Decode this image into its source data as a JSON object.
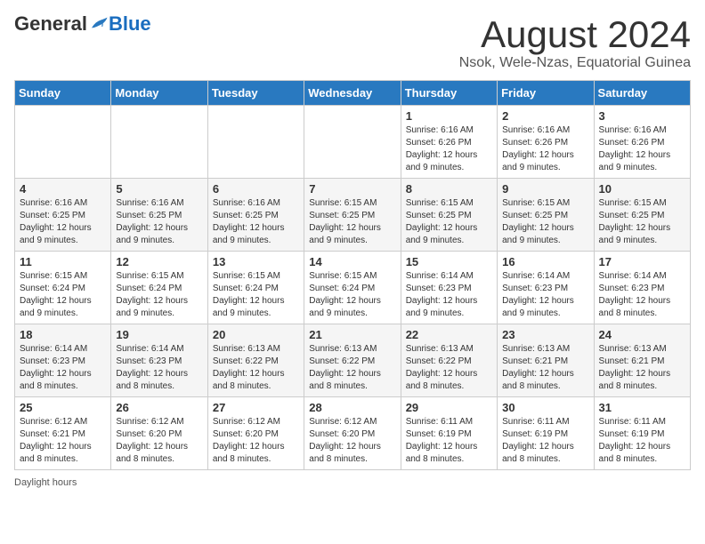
{
  "logo": {
    "general": "General",
    "blue": "Blue"
  },
  "header": {
    "title": "August 2024",
    "subtitle": "Nsok, Wele-Nzas, Equatorial Guinea"
  },
  "weekdays": [
    "Sunday",
    "Monday",
    "Tuesday",
    "Wednesday",
    "Thursday",
    "Friday",
    "Saturday"
  ],
  "weeks": [
    [
      {
        "day": "",
        "info": ""
      },
      {
        "day": "",
        "info": ""
      },
      {
        "day": "",
        "info": ""
      },
      {
        "day": "",
        "info": ""
      },
      {
        "day": "1",
        "info": "Sunrise: 6:16 AM\nSunset: 6:26 PM\nDaylight: 12 hours\nand 9 minutes."
      },
      {
        "day": "2",
        "info": "Sunrise: 6:16 AM\nSunset: 6:26 PM\nDaylight: 12 hours\nand 9 minutes."
      },
      {
        "day": "3",
        "info": "Sunrise: 6:16 AM\nSunset: 6:26 PM\nDaylight: 12 hours\nand 9 minutes."
      }
    ],
    [
      {
        "day": "4",
        "info": "Sunrise: 6:16 AM\nSunset: 6:25 PM\nDaylight: 12 hours\nand 9 minutes."
      },
      {
        "day": "5",
        "info": "Sunrise: 6:16 AM\nSunset: 6:25 PM\nDaylight: 12 hours\nand 9 minutes."
      },
      {
        "day": "6",
        "info": "Sunrise: 6:16 AM\nSunset: 6:25 PM\nDaylight: 12 hours\nand 9 minutes."
      },
      {
        "day": "7",
        "info": "Sunrise: 6:15 AM\nSunset: 6:25 PM\nDaylight: 12 hours\nand 9 minutes."
      },
      {
        "day": "8",
        "info": "Sunrise: 6:15 AM\nSunset: 6:25 PM\nDaylight: 12 hours\nand 9 minutes."
      },
      {
        "day": "9",
        "info": "Sunrise: 6:15 AM\nSunset: 6:25 PM\nDaylight: 12 hours\nand 9 minutes."
      },
      {
        "day": "10",
        "info": "Sunrise: 6:15 AM\nSunset: 6:25 PM\nDaylight: 12 hours\nand 9 minutes."
      }
    ],
    [
      {
        "day": "11",
        "info": "Sunrise: 6:15 AM\nSunset: 6:24 PM\nDaylight: 12 hours\nand 9 minutes."
      },
      {
        "day": "12",
        "info": "Sunrise: 6:15 AM\nSunset: 6:24 PM\nDaylight: 12 hours\nand 9 minutes."
      },
      {
        "day": "13",
        "info": "Sunrise: 6:15 AM\nSunset: 6:24 PM\nDaylight: 12 hours\nand 9 minutes."
      },
      {
        "day": "14",
        "info": "Sunrise: 6:15 AM\nSunset: 6:24 PM\nDaylight: 12 hours\nand 9 minutes."
      },
      {
        "day": "15",
        "info": "Sunrise: 6:14 AM\nSunset: 6:23 PM\nDaylight: 12 hours\nand 9 minutes."
      },
      {
        "day": "16",
        "info": "Sunrise: 6:14 AM\nSunset: 6:23 PM\nDaylight: 12 hours\nand 9 minutes."
      },
      {
        "day": "17",
        "info": "Sunrise: 6:14 AM\nSunset: 6:23 PM\nDaylight: 12 hours\nand 8 minutes."
      }
    ],
    [
      {
        "day": "18",
        "info": "Sunrise: 6:14 AM\nSunset: 6:23 PM\nDaylight: 12 hours\nand 8 minutes."
      },
      {
        "day": "19",
        "info": "Sunrise: 6:14 AM\nSunset: 6:23 PM\nDaylight: 12 hours\nand 8 minutes."
      },
      {
        "day": "20",
        "info": "Sunrise: 6:13 AM\nSunset: 6:22 PM\nDaylight: 12 hours\nand 8 minutes."
      },
      {
        "day": "21",
        "info": "Sunrise: 6:13 AM\nSunset: 6:22 PM\nDaylight: 12 hours\nand 8 minutes."
      },
      {
        "day": "22",
        "info": "Sunrise: 6:13 AM\nSunset: 6:22 PM\nDaylight: 12 hours\nand 8 minutes."
      },
      {
        "day": "23",
        "info": "Sunrise: 6:13 AM\nSunset: 6:21 PM\nDaylight: 12 hours\nand 8 minutes."
      },
      {
        "day": "24",
        "info": "Sunrise: 6:13 AM\nSunset: 6:21 PM\nDaylight: 12 hours\nand 8 minutes."
      }
    ],
    [
      {
        "day": "25",
        "info": "Sunrise: 6:12 AM\nSunset: 6:21 PM\nDaylight: 12 hours\nand 8 minutes."
      },
      {
        "day": "26",
        "info": "Sunrise: 6:12 AM\nSunset: 6:20 PM\nDaylight: 12 hours\nand 8 minutes."
      },
      {
        "day": "27",
        "info": "Sunrise: 6:12 AM\nSunset: 6:20 PM\nDaylight: 12 hours\nand 8 minutes."
      },
      {
        "day": "28",
        "info": "Sunrise: 6:12 AM\nSunset: 6:20 PM\nDaylight: 12 hours\nand 8 minutes."
      },
      {
        "day": "29",
        "info": "Sunrise: 6:11 AM\nSunset: 6:19 PM\nDaylight: 12 hours\nand 8 minutes."
      },
      {
        "day": "30",
        "info": "Sunrise: 6:11 AM\nSunset: 6:19 PM\nDaylight: 12 hours\nand 8 minutes."
      },
      {
        "day": "31",
        "info": "Sunrise: 6:11 AM\nSunset: 6:19 PM\nDaylight: 12 hours\nand 8 minutes."
      }
    ]
  ],
  "footer": {
    "note": "Daylight hours"
  }
}
